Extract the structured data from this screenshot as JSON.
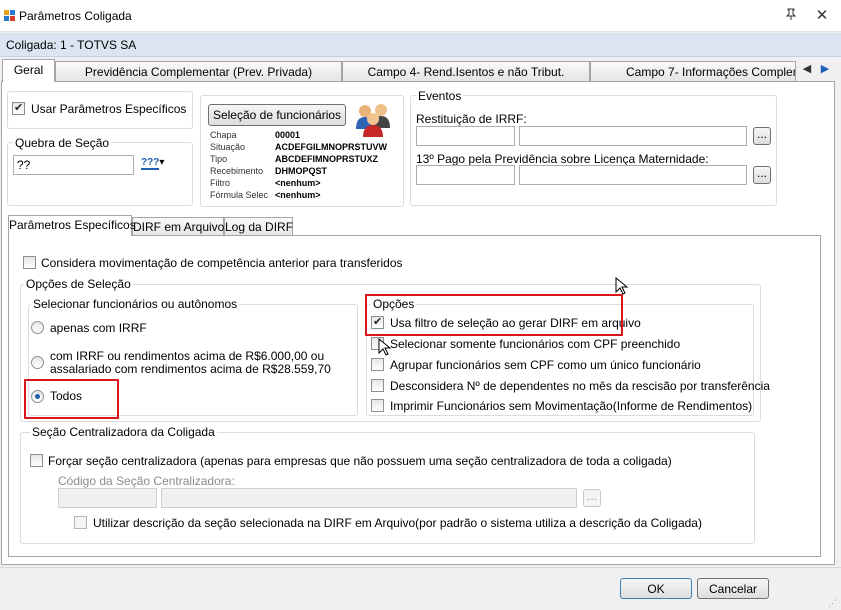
{
  "window": {
    "title": "Parâmetros Coligada",
    "pin_icon": "pin-icon",
    "close_label": "✕"
  },
  "coligada": "Coligada: 1 - TOTVS SA",
  "main_tabs": [
    "Geral",
    "Previdência Complementar (Prev. Privada)",
    "Campo 4- Rend.Isentos e não Tribut.",
    "Campo 7- Informações Compleme"
  ],
  "geral": {
    "usar_parametros": "Usar Parâmetros Específicos",
    "usar_parametros_checked": true,
    "quebra_label": "Quebra de Seção",
    "quebra_value": "??",
    "quebra_btn_icon": "???",
    "selecao_btn": "Seleção de funcionários",
    "selecao_fields": [
      {
        "label": "Chapa",
        "value": "00001"
      },
      {
        "label": "Situação",
        "value": "ACDEFGILMNOPRSTUVW"
      },
      {
        "label": "Tipo",
        "value": "ABCDEFIMNOPRSTUXZ"
      },
      {
        "label": "Recebimento",
        "value": "DHMOPQST"
      },
      {
        "label": "Filtro",
        "value": "<nenhum>"
      },
      {
        "label": "Fórmula Selec",
        "value": "<nenhum>"
      }
    ],
    "eventos": {
      "title": "Eventos",
      "restituicao_label": "Restituição de IRRF:",
      "decimo_label": "13º Pago pela Previdência sobre Licença Maternidade:",
      "lookup_label": "..."
    }
  },
  "inner_tabs": [
    "Parâmetros Específicos",
    "DIRF em Arquivo",
    "Log da DIRF"
  ],
  "especificos": {
    "considera_mov": "Considera movimentação de competência anterior para transferidos",
    "opcoes_selecao": "Opções de Seleção",
    "selecionar_group": "Selecionar funcionários ou autônomos",
    "radios": [
      {
        "label": "apenas com IRRF",
        "checked": false
      },
      {
        "label": "com IRRF ou rendimentos acima de R$6.000,00 ou",
        "label2": "assalariado com rendimentos acima de R$28.559,70",
        "checked": false
      },
      {
        "label": "Todos",
        "checked": true
      }
    ],
    "opcoes_group": "Opções",
    "opcoes": [
      {
        "label": "Usa filtro de seleção ao gerar DIRF em arquivo",
        "checked": true
      },
      {
        "label": "Selecionar somente funcionários com CPF preenchido",
        "checked": false
      },
      {
        "label": "Agrupar funcionários sem CPF como um único funcionário",
        "checked": false
      },
      {
        "label": "Desconsidera Nº de dependentes no mês da rescisão por transferência",
        "checked": false
      },
      {
        "label": "Imprimir Funcionários sem Movimentação(Informe de Rendimentos)",
        "checked": false
      }
    ],
    "secao_group": "Seção Centralizadora da Coligada",
    "forcar": "Forçar seção centralizadora  (apenas para empresas que não possuem uma seção centralizadora de toda a coligada)",
    "codigo_label": "Código da Seção Centralizadora:",
    "utilizar": "Utilizar descrição da seção selecionada na DIRF em Arquivo(por padrão o sistema utiliza a descrição da Coligada)"
  },
  "footer": {
    "ok": "OK",
    "cancel": "Cancelar"
  },
  "colors": {
    "highlight_red": "#d9161b",
    "header_blue": "#dbe5f1"
  }
}
